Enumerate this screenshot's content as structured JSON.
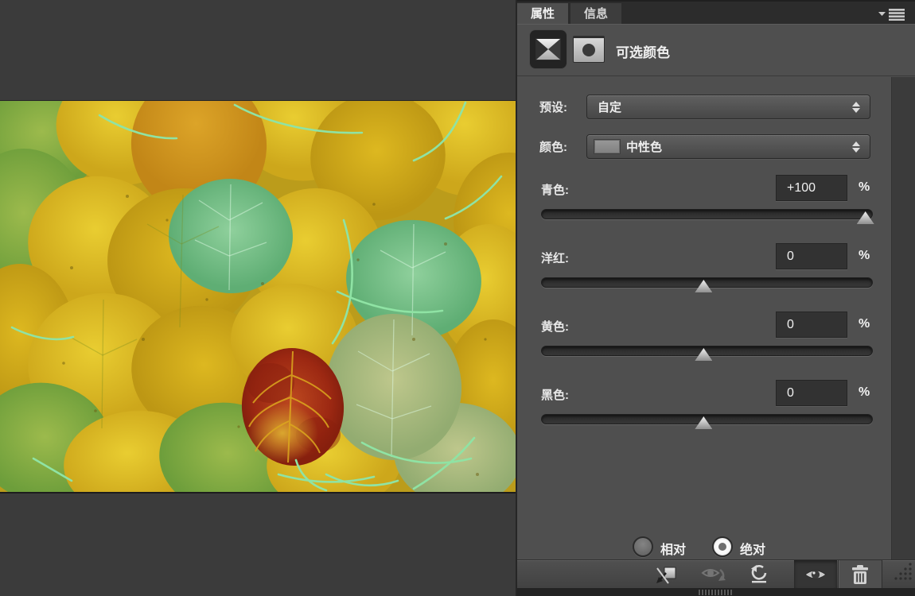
{
  "colors": {
    "canvas_bg": "#3b3b3b",
    "panel_bg": "#4f4f4f",
    "tabbar_bg": "#2c2c2c",
    "field_bg": "#323232",
    "text": "#e8e8e8",
    "stem_accent": "#8fe3a4",
    "red_leaf": "#a52c12",
    "leaf_yellow": "#d4b11e",
    "leaf_green": "#7fae4e",
    "leaf_teal": "#6fbd86",
    "neutral_swatch": "#8c8c8c"
  },
  "photo": {
    "description": "Overlapping autumn aspen leaves in yellow, green and teal tones with a single red leaf near bottom center and pale cyan-green stems"
  },
  "panel": {
    "tabs": [
      {
        "label": "属性",
        "active": true
      },
      {
        "label": "信息",
        "active": false
      }
    ],
    "header": {
      "title": "可选颜色"
    },
    "preset_row": {
      "label": "预设:",
      "value": "自定"
    },
    "color_row": {
      "label": "颜色:",
      "value": "中性色",
      "swatch_color": "#8c8c8c"
    },
    "sliders": [
      {
        "label": "青色:",
        "value": "+100",
        "unit": "%",
        "position_pct": 98
      },
      {
        "label": "洋红:",
        "value": "0",
        "unit": "%",
        "position_pct": 49
      },
      {
        "label": "黄色:",
        "value": "0",
        "unit": "%",
        "position_pct": 49
      },
      {
        "label": "黑色:",
        "value": "0",
        "unit": "%",
        "position_pct": 49
      }
    ],
    "method_radios": [
      {
        "label": "相对",
        "selected": false
      },
      {
        "label": "绝对",
        "selected": true
      }
    ],
    "footer_icons": [
      {
        "name": "clip-to-layer"
      },
      {
        "name": "view-previous-state"
      },
      {
        "name": "reset"
      },
      {
        "name": "visibility",
        "pressed": true
      },
      {
        "name": "delete"
      }
    ]
  }
}
